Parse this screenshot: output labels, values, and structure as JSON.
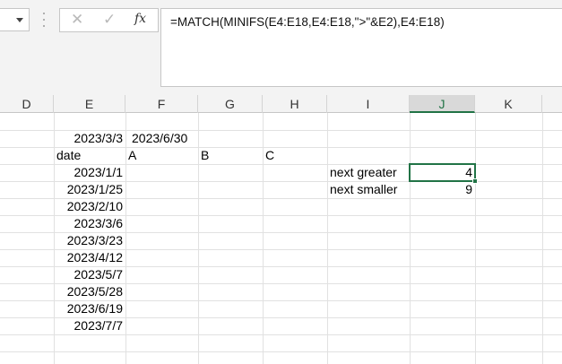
{
  "formula_bar": {
    "cancel_glyph": "✕",
    "enter_glyph": "✓",
    "fx_label": "fx",
    "formula": "=MATCH(MINIFS(E4:E18,E4:E18,\">\"&E2),E4:E18)"
  },
  "columns": [
    "D",
    "E",
    "F",
    "G",
    "H",
    "I",
    "J",
    "K"
  ],
  "selected_column": "J",
  "cells": {
    "E2": "2023/3/3",
    "F2": "2023/6/30",
    "E3": "date",
    "F3": "A",
    "G3": "B",
    "H3": "C",
    "E4": "2023/1/1",
    "E5": "2023/1/25",
    "E6": "2023/2/10",
    "E7": "2023/3/6",
    "E8": "2023/3/23",
    "E9": "2023/4/12",
    "E10": "2023/5/7",
    "E11": "2023/5/28",
    "E12": "2023/6/19",
    "E13": "2023/7/7",
    "I4": "next greater",
    "J4": "4",
    "I5": "next smaller",
    "J5": "9"
  },
  "colors": {
    "accent": "#217346",
    "gridline": "#e1e1e1",
    "header_bg": "#f3f3f3"
  }
}
